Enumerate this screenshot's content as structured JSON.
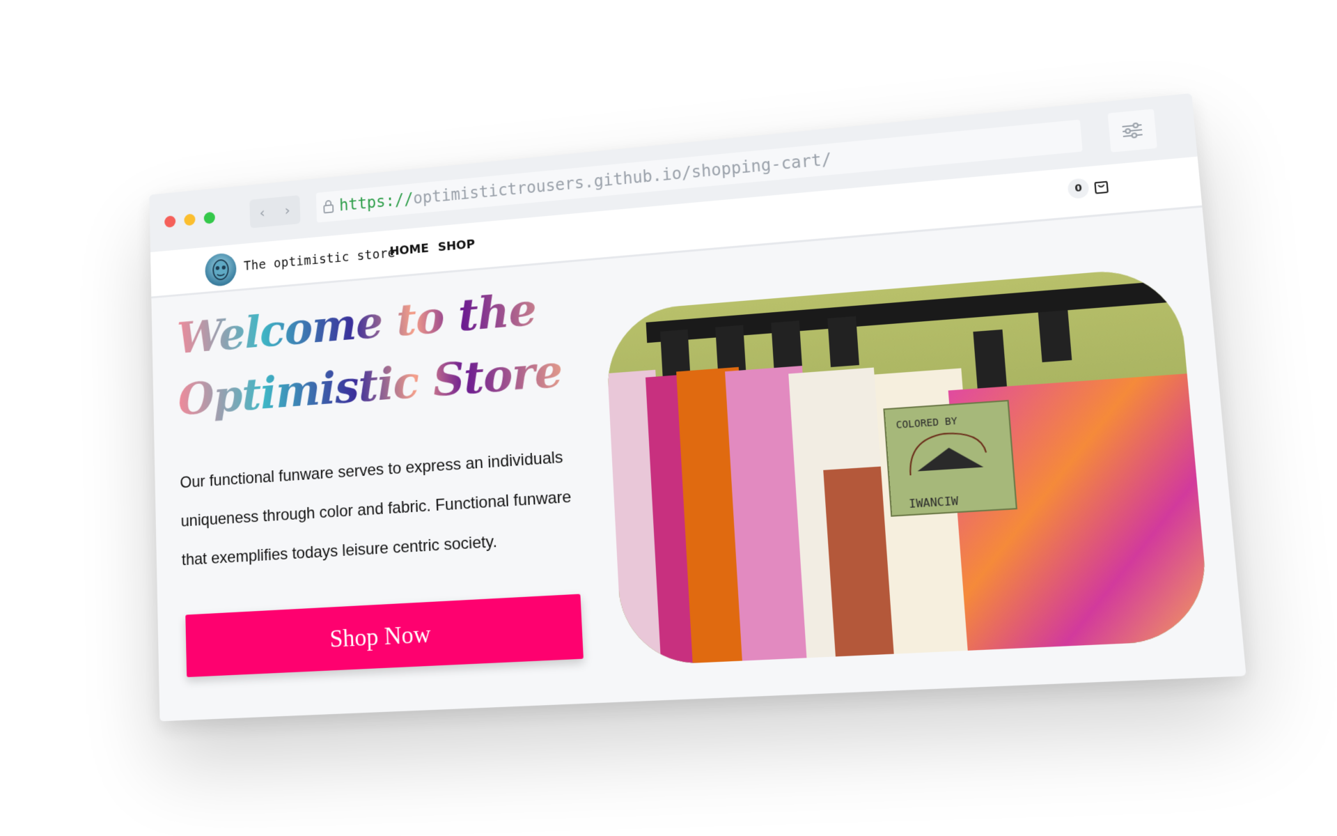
{
  "browser": {
    "url_protocol": "https://",
    "url_rest": "optimistictrousers.github.io/shopping-cart/",
    "icons": {
      "back": "chevron-left-icon",
      "forward": "chevron-right-icon",
      "lock": "lock-icon",
      "settings": "sliders-icon"
    },
    "window_dots": [
      "#f5605a",
      "#fbbe2e",
      "#34c84a"
    ]
  },
  "header": {
    "store_name": "The optimistic store",
    "nav": [
      "HOME",
      "SHOP"
    ],
    "cart_count": "0",
    "cart_icon": "shopping-bag-icon"
  },
  "hero": {
    "title_line1": "Welcome to the",
    "title_line2": "Optimistic Store",
    "description": "Our functional funware serves to express an individuals uniqueness through color and fabric. Functional funware that exemplifies todays leisure centric society.",
    "button_label": "Shop Now",
    "button_color": "#fe016f"
  },
  "product_image": {
    "tag_top": "COLORED BY",
    "tag_bottom": "IWANCIW"
  }
}
